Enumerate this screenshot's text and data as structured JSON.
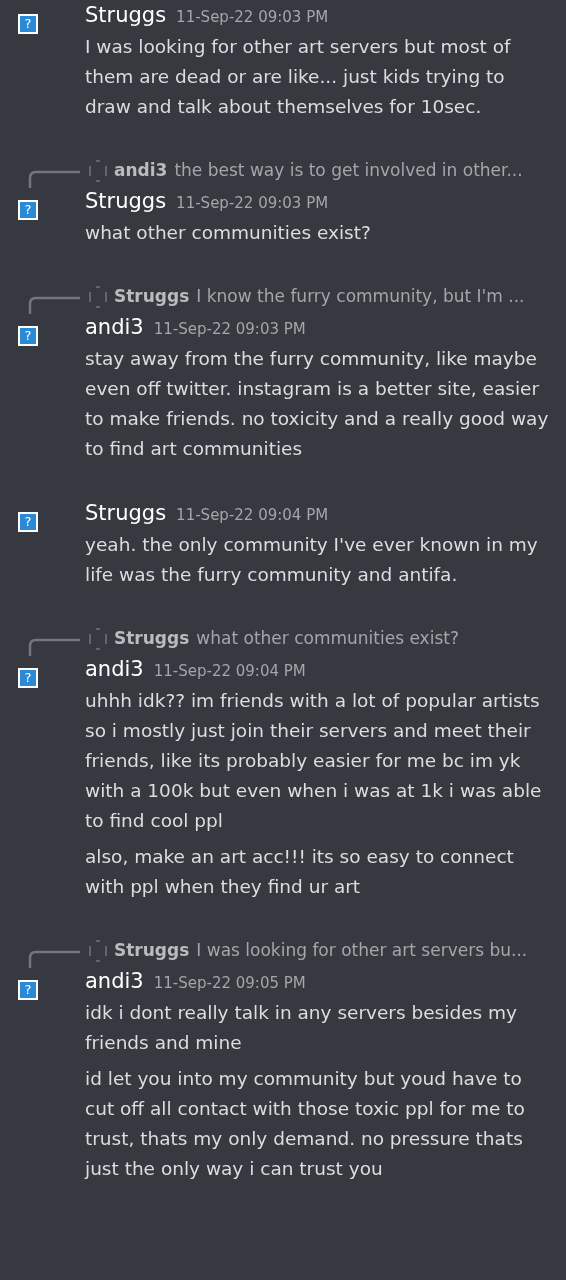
{
  "messages": [
    {
      "avatar": "?",
      "author": "Struggs",
      "time": "11-Sep-22 09:03 PM",
      "paragraphs": [
        "I was looking for other art servers but most of them are dead or are like... just kids trying to draw and talk about themselves for 10sec."
      ]
    },
    {
      "reply": {
        "author": "andi3",
        "text": "the best way is to get involved in other..."
      },
      "avatar": "?",
      "author": "Struggs",
      "time": "11-Sep-22 09:03 PM",
      "paragraphs": [
        "what other communities exist?"
      ]
    },
    {
      "reply": {
        "author": "Struggs",
        "text": "I know the furry community, but I'm ..."
      },
      "avatar": "?",
      "author": "andi3",
      "time": "11-Sep-22 09:03 PM",
      "paragraphs": [
        "stay away from the furry community, like maybe even off twitter. instagram is a better site, easier to make friends. no toxicity and a really good way to find art communities"
      ]
    },
    {
      "avatar": "?",
      "author": "Struggs",
      "time": "11-Sep-22 09:04 PM",
      "paragraphs": [
        "yeah. the only community I've ever known in my life was the furry community and antifa."
      ]
    },
    {
      "reply": {
        "author": "Struggs",
        "text": "what other communities exist?"
      },
      "avatar": "?",
      "author": "andi3",
      "time": "11-Sep-22 09:04 PM",
      "paragraphs": [
        "uhhh idk?? im friends with a lot of popular artists so i mostly just join their servers and meet their friends, like its probably easier for me bc im yk with a 100k but even when i was at 1k i was able to find cool ppl",
        "also, make an art acc!!! its so easy to connect with ppl when they find ur art"
      ]
    },
    {
      "reply": {
        "author": "Struggs",
        "text": "I was looking for other art servers bu..."
      },
      "avatar": "?",
      "author": "andi3",
      "time": "11-Sep-22 09:05 PM",
      "paragraphs": [
        "idk i dont really talk in any servers besides my friends and mine",
        "id let you into my community but youd have to cut off all contact with those toxic ppl for me to trust, thats my only demand. no pressure thats just the only way i can trust you"
      ]
    }
  ]
}
